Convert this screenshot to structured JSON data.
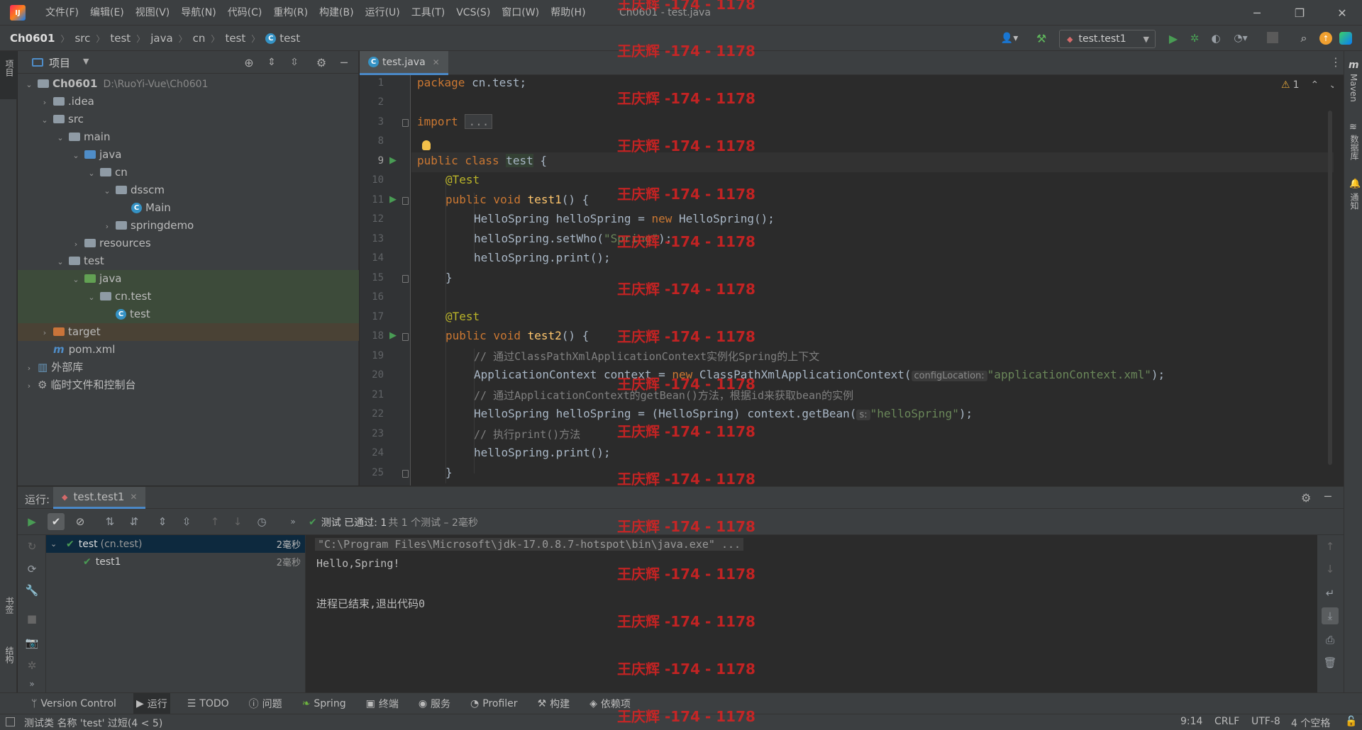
{
  "menu": [
    "文件(F)",
    "编辑(E)",
    "视图(V)",
    "导航(N)",
    "代码(C)",
    "重构(R)",
    "构建(B)",
    "运行(U)",
    "工具(T)",
    "VCS(S)",
    "窗口(W)",
    "帮助(H)"
  ],
  "window_title": "Ch0601 - test.java",
  "breadcrumb": [
    "Ch0601",
    "src",
    "test",
    "java",
    "cn",
    "test",
    "test"
  ],
  "run_config": "test.test1",
  "project_panel": {
    "title": "项目",
    "tree": [
      {
        "label": "Ch0601",
        "extra": "D:\\RuoYi-Vue\\Ch0601",
        "depth": 0,
        "arrow": "open",
        "kind": "module"
      },
      {
        "label": ".idea",
        "depth": 1,
        "arrow": "closed",
        "kind": "folder"
      },
      {
        "label": "src",
        "depth": 1,
        "arrow": "open",
        "kind": "folder"
      },
      {
        "label": "main",
        "depth": 2,
        "arrow": "open",
        "kind": "folder"
      },
      {
        "label": "java",
        "depth": 3,
        "arrow": "open",
        "kind": "blue"
      },
      {
        "label": "cn",
        "depth": 4,
        "arrow": "open",
        "kind": "pkg"
      },
      {
        "label": "dsscm",
        "depth": 5,
        "arrow": "open",
        "kind": "pkg"
      },
      {
        "label": "Main",
        "depth": 6,
        "arrow": "none",
        "kind": "class"
      },
      {
        "label": "springdemo",
        "depth": 5,
        "arrow": "closed",
        "kind": "pkg"
      },
      {
        "label": "resources",
        "depth": 3,
        "arrow": "closed",
        "kind": "folder"
      },
      {
        "label": "test",
        "depth": 2,
        "arrow": "open",
        "kind": "folder"
      },
      {
        "label": "java",
        "depth": 3,
        "arrow": "open",
        "kind": "green"
      },
      {
        "label": "cn.test",
        "depth": 4,
        "arrow": "open",
        "kind": "pkg"
      },
      {
        "label": "test",
        "depth": 5,
        "arrow": "none",
        "kind": "class"
      },
      {
        "label": "target",
        "depth": 1,
        "arrow": "closed",
        "kind": "orange"
      },
      {
        "label": "pom.xml",
        "depth": 1,
        "arrow": "none",
        "kind": "maven"
      },
      {
        "label": "外部库",
        "depth": 0,
        "arrow": "closed",
        "kind": "lib"
      },
      {
        "label": "临时文件和控制台",
        "depth": 0,
        "arrow": "closed",
        "kind": "scratch"
      }
    ]
  },
  "editor": {
    "tab": "test.java",
    "warnings": "1",
    "line_numbers": [
      "1",
      "2",
      "3",
      "8",
      "9",
      "10",
      "11",
      "12",
      "13",
      "14",
      "15",
      "16",
      "17",
      "18",
      "19",
      "20",
      "21",
      "22",
      "23",
      "24",
      "25"
    ]
  },
  "code": {
    "l1_kw": "package",
    "l1_rest": " cn.test;",
    "l3_kw": "import",
    "l3_fold": "...",
    "l9_kw": "public class",
    "l9_name": "test",
    "l9_rest": " {",
    "l10": "@Test",
    "l11_kw": "public void",
    "l11_fn": "test1",
    "l11_rest": "() {",
    "l12_a": "HelloSpring helloSpring = ",
    "l12_kw": "new",
    "l12_b": " HelloSpring();",
    "l13_a": "helloSpring.setWho(",
    "l13_str": "\"Spring\"",
    "l13_b": ");",
    "l14": "helloSpring.print();",
    "l15": "}",
    "l17": "@Test",
    "l18_kw": "public void",
    "l18_fn": "test2",
    "l18_rest": "() {",
    "l19": "// 通过ClassPathXmlApplicationContext实例化Spring的上下文",
    "l20_a": "ApplicationContext context = ",
    "l20_kw": "new",
    "l20_b": " ClassPathXmlApplicationContext(",
    "l20_hint": "configLocation:",
    "l20_str": "\"applicationContext.xml\"",
    "l20_c": ");",
    "l21": "// 通过ApplicationContext的getBean()方法，根据id来获取bean的实例",
    "l22_a": "HelloSpring helloSpring = (HelloSpring) context.getBean(",
    "l22_hint": "s:",
    "l22_str": "\"helloSpring\"",
    "l22_c": ");",
    "l23": "// 执行print()方法",
    "l24": "helloSpring.print();",
    "l25": "}"
  },
  "run_panel": {
    "label": "运行:",
    "tab": "test.test1",
    "status_text": "测试 已通过: 1",
    "status_detail": "共 1 个测试 – 2毫秒",
    "tests": [
      {
        "name": "test",
        "pkg": "(cn.test)",
        "time": "2毫秒"
      },
      {
        "name": "test1",
        "pkg": "",
        "time": "2毫秒"
      }
    ],
    "console": [
      "\"C:\\Program Files\\Microsoft\\jdk-17.0.8.7-hotspot\\bin\\java.exe\" ...",
      "Hello,Spring!",
      "",
      "进程已结束,退出代码0"
    ]
  },
  "bottom_tabs": [
    "Version Control",
    "运行",
    "TODO",
    "问题",
    "Spring",
    "终端",
    "服务",
    "Profiler",
    "构建",
    "依赖项"
  ],
  "status": {
    "message": "测试类 名称 'test' 过短(4 < 5)",
    "position": "9:14",
    "line_sep": "CRLF",
    "encoding": "UTF-8",
    "indent": "4 个空格"
  },
  "side_labels": {
    "left_top": "项目",
    "left_bookmarks": "书签",
    "left_structure": "结构",
    "right_maven": "Maven",
    "right_db": "数据库",
    "right_notify": "通知"
  },
  "watermark": "王庆辉 -174 - 1178",
  "colors": {
    "accent": "#4a88c7",
    "run_green": "#499c54",
    "warning": "#e2a53a"
  }
}
